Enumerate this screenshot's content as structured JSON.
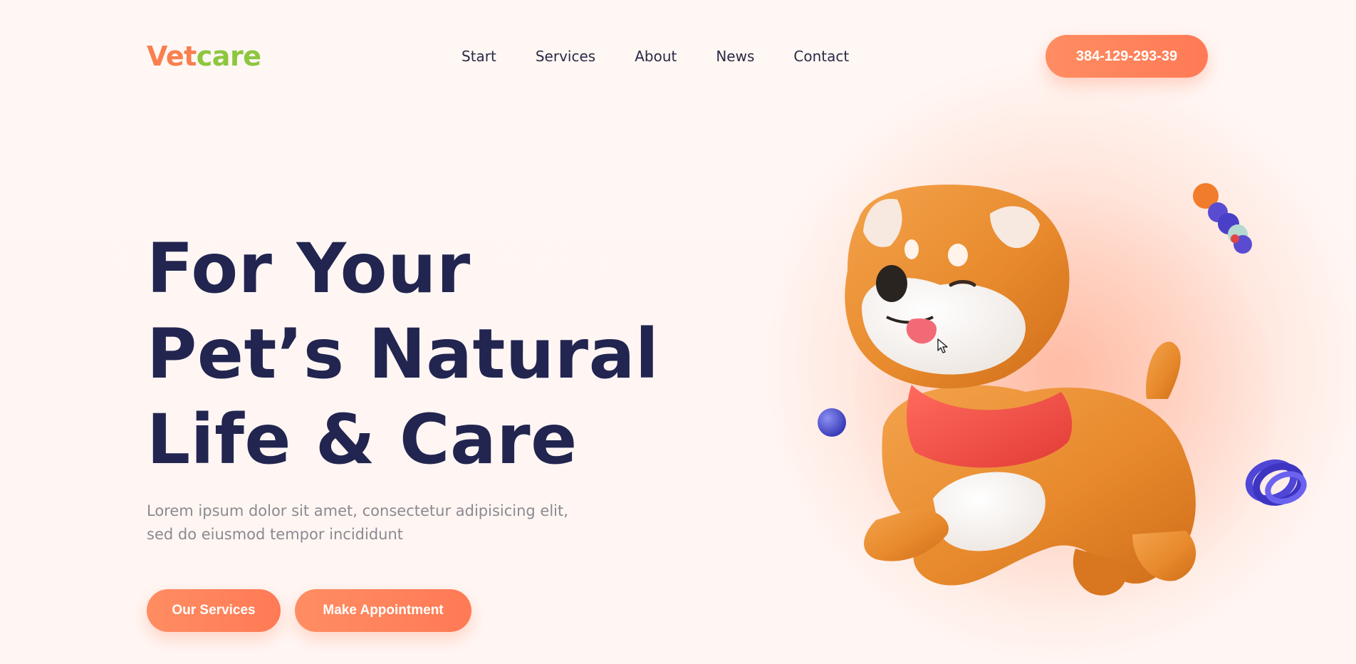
{
  "brand": {
    "logo_part1": "Vet",
    "logo_part2": "care"
  },
  "nav": {
    "items": [
      {
        "label": "Start"
      },
      {
        "label": "Services"
      },
      {
        "label": "About"
      },
      {
        "label": "News"
      },
      {
        "label": "Contact"
      }
    ]
  },
  "header": {
    "phone_label": "384-129-293-39"
  },
  "hero": {
    "title_lines": [
      "For Your",
      "Pet’s Natural",
      "Life & Care"
    ],
    "body_lines": [
      "Lorem ipsum dolor sit amet, consectetur adipisicing elit,",
      "sed do eiusmod tempor incididunt"
    ],
    "buttons": {
      "services_label": "Our Services",
      "appointment_label": "Make Appointment"
    }
  },
  "illustration": {
    "subject": "dog-illustration",
    "decorations": [
      "bone-toy-icon",
      "ball-icon",
      "spring-toy-icon"
    ]
  },
  "colors": {
    "brand_orange": "#f97f4f",
    "brand_green": "#8dc63f",
    "heading_navy": "#22254f",
    "button_orange": "#ff7a55",
    "background": "#fff6f3"
  }
}
